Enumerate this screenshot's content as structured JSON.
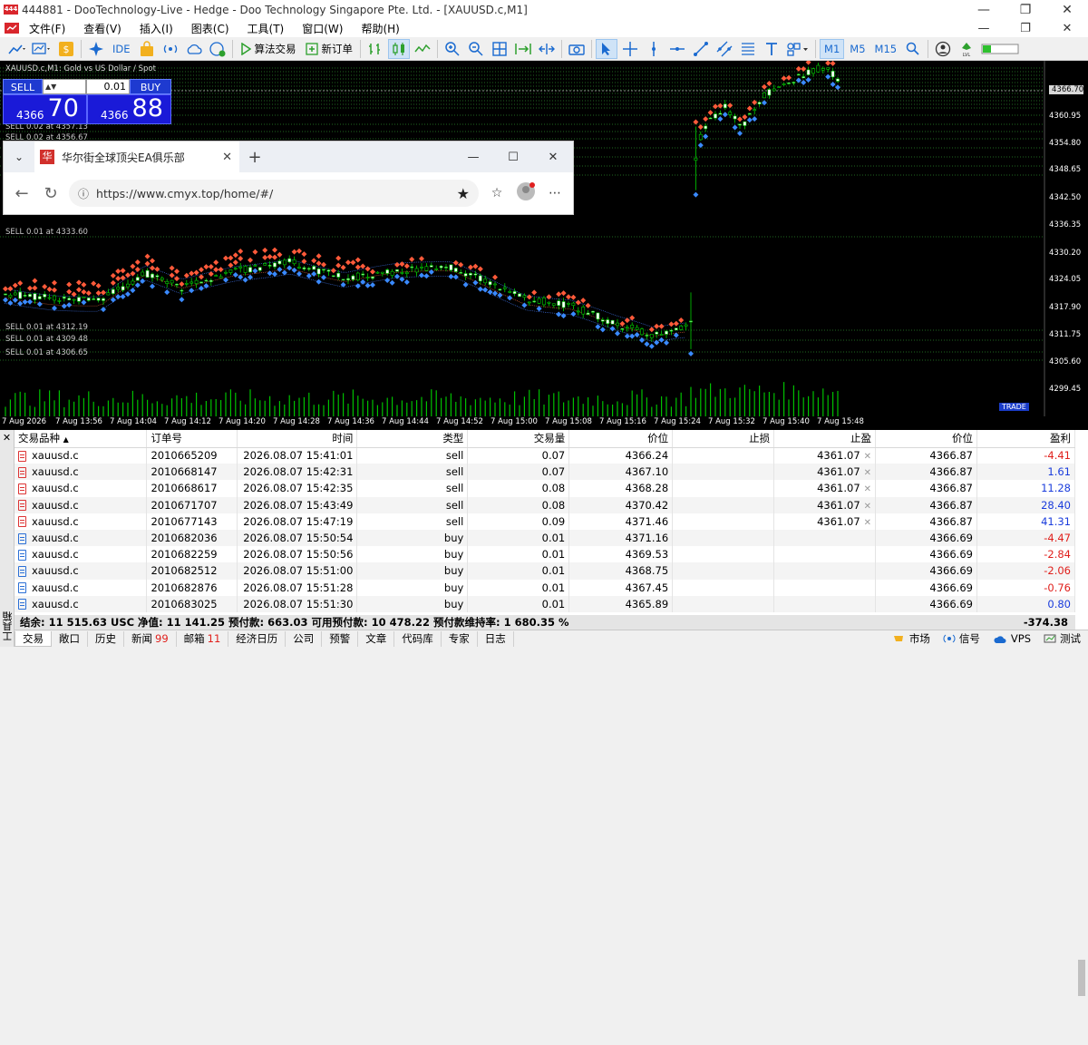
{
  "window": {
    "title": "444881 - DooTechnology-Live - Hedge - Doo Technology Singapore Pte. Ltd. - [XAUUSD.c,M1]",
    "minimize": "—",
    "restore": "❐",
    "close": "✕"
  },
  "menu": {
    "items": [
      "文件(F)",
      "查看(V)",
      "插入(I)",
      "图表(C)",
      "工具(T)",
      "窗口(W)",
      "帮助(H)"
    ],
    "minimize": "—",
    "restore": "❐",
    "close": "✕"
  },
  "toolbar": {
    "ide_label": "IDE",
    "algo_label": "算法交易",
    "new_order_label": "新订单",
    "timeframes": [
      "M1",
      "M5",
      "M15"
    ],
    "selected_timeframe": "M1"
  },
  "chart": {
    "symbol_title": "XAUUSD.c,M1:  Gold vs US Dollar / Spot",
    "current_price": "4366.70",
    "y_labels": [
      "4360.95",
      "4354.80",
      "4348.65",
      "4342.50",
      "4336.35",
      "4330.20",
      "4324.05",
      "4317.90",
      "4311.75",
      "4305.60",
      "4299.45"
    ],
    "x_labels": [
      "7 Aug 2026",
      "7 Aug 13:56",
      "7 Aug 14:04",
      "7 Aug 14:12",
      "7 Aug 14:20",
      "7 Aug 14:28",
      "7 Aug 14:36",
      "7 Aug 14:44",
      "7 Aug 14:52",
      "7 Aug 15:00",
      "7 Aug 15:08",
      "7 Aug 15:16",
      "7 Aug 15:24",
      "7 Aug 15:32",
      "7 Aug 15:40",
      "7 Aug 15:48"
    ],
    "order_lines": [
      "SELL 0.02 at 4357.13",
      "SELL 0.02 at 4356.67",
      "SELL 0.01 at 4333.60",
      "SELL 0.01 at 4312.19",
      "SELL 0.01 at 4309.48",
      "SELL 0.01 at 4306.65"
    ],
    "bottom_right_tag": "TRADE"
  },
  "trade_panel": {
    "sell_label": "SELL",
    "buy_label": "BUY",
    "lot": "0.01",
    "sell_small": "4366",
    "sell_big": "70",
    "buy_small": "4366",
    "buy_big": "88"
  },
  "browser": {
    "tab_title": "华尔街全球顶尖EA俱乐部",
    "favicon": "华",
    "url": "https://www.cmyx.top/home/#/"
  },
  "terminal": {
    "side_label": "工具箱",
    "columns": [
      "交易品种",
      "订单号",
      "时间",
      "类型",
      "交易量",
      "价位",
      "止损",
      "止盈",
      "价位",
      "盈利"
    ],
    "rows": [
      {
        "symbol": "xauusd.c",
        "order": "2010665209",
        "time": "2026.08.07 15:41:01",
        "type": "sell",
        "volume": "0.07",
        "price": "4366.24",
        "sl": "",
        "tp": "4361.07",
        "cur": "4366.87",
        "profit": "-4.41",
        "kind": "sell",
        "sign": "neg"
      },
      {
        "symbol": "xauusd.c",
        "order": "2010668147",
        "time": "2026.08.07 15:42:31",
        "type": "sell",
        "volume": "0.07",
        "price": "4367.10",
        "sl": "",
        "tp": "4361.07",
        "cur": "4366.87",
        "profit": "1.61",
        "kind": "sell",
        "sign": "pos"
      },
      {
        "symbol": "xauusd.c",
        "order": "2010668617",
        "time": "2026.08.07 15:42:35",
        "type": "sell",
        "volume": "0.08",
        "price": "4368.28",
        "sl": "",
        "tp": "4361.07",
        "cur": "4366.87",
        "profit": "11.28",
        "kind": "sell",
        "sign": "pos"
      },
      {
        "symbol": "xauusd.c",
        "order": "2010671707",
        "time": "2026.08.07 15:43:49",
        "type": "sell",
        "volume": "0.08",
        "price": "4370.42",
        "sl": "",
        "tp": "4361.07",
        "cur": "4366.87",
        "profit": "28.40",
        "kind": "sell",
        "sign": "pos"
      },
      {
        "symbol": "xauusd.c",
        "order": "2010677143",
        "time": "2026.08.07 15:47:19",
        "type": "sell",
        "volume": "0.09",
        "price": "4371.46",
        "sl": "",
        "tp": "4361.07",
        "cur": "4366.87",
        "profit": "41.31",
        "kind": "sell",
        "sign": "pos"
      },
      {
        "symbol": "xauusd.c",
        "order": "2010682036",
        "time": "2026.08.07 15:50:54",
        "type": "buy",
        "volume": "0.01",
        "price": "4371.16",
        "sl": "",
        "tp": "",
        "cur": "4366.69",
        "profit": "-4.47",
        "kind": "buy",
        "sign": "neg"
      },
      {
        "symbol": "xauusd.c",
        "order": "2010682259",
        "time": "2026.08.07 15:50:56",
        "type": "buy",
        "volume": "0.01",
        "price": "4369.53",
        "sl": "",
        "tp": "",
        "cur": "4366.69",
        "profit": "-2.84",
        "kind": "buy",
        "sign": "neg"
      },
      {
        "symbol": "xauusd.c",
        "order": "2010682512",
        "time": "2026.08.07 15:51:00",
        "type": "buy",
        "volume": "0.01",
        "price": "4368.75",
        "sl": "",
        "tp": "",
        "cur": "4366.69",
        "profit": "-2.06",
        "kind": "buy",
        "sign": "neg"
      },
      {
        "symbol": "xauusd.c",
        "order": "2010682876",
        "time": "2026.08.07 15:51:28",
        "type": "buy",
        "volume": "0.01",
        "price": "4367.45",
        "sl": "",
        "tp": "",
        "cur": "4366.69",
        "profit": "-0.76",
        "kind": "buy",
        "sign": "neg"
      },
      {
        "symbol": "xauusd.c",
        "order": "2010683025",
        "time": "2026.08.07 15:51:30",
        "type": "buy",
        "volume": "0.01",
        "price": "4365.89",
        "sl": "",
        "tp": "",
        "cur": "4366.69",
        "profit": "0.80",
        "kind": "buy",
        "sign": "pos"
      }
    ],
    "summary": "结余: 11 515.63 USC  净值: 11 141.25  预付款: 663.03  可用预付款: 10 478.22  预付款维持率: 1 680.35 %",
    "total": "-374.38",
    "tabs": [
      {
        "label": "交易"
      },
      {
        "label": "敞口"
      },
      {
        "label": "历史"
      },
      {
        "label": "新闻",
        "badge": "99"
      },
      {
        "label": "邮箱",
        "badge": "11"
      },
      {
        "label": "经济日历"
      },
      {
        "label": "公司"
      },
      {
        "label": "预警"
      },
      {
        "label": "文章"
      },
      {
        "label": "代码库"
      },
      {
        "label": "专家"
      },
      {
        "label": "日志"
      }
    ],
    "status": {
      "market": "市场",
      "signal": "信号",
      "vps": "VPS",
      "test": "测试"
    }
  },
  "colors": {
    "bull": "#00d000",
    "bear": "#ff3030",
    "bg": "#000000",
    "profit_pos": "#1a3cdc",
    "profit_neg": "#e0201c"
  }
}
